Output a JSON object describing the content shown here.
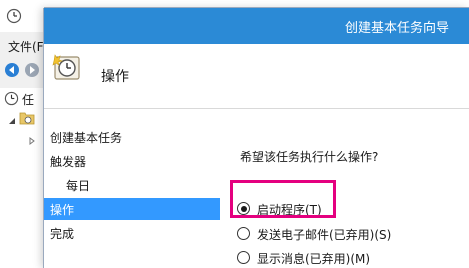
{
  "background_app": {
    "menu": {
      "file_label": "文件(F"
    },
    "tree": {
      "root_label": "任",
      "child_label": ""
    },
    "icons": {
      "app_icon": "clock-icon",
      "back": "back-arrow-icon",
      "forward": "forward-arrow-icon",
      "tree_root": "clock-icon",
      "tree_folder": "folder-icon",
      "tree_expand": "triangle-expand-icon",
      "tree_collapsed": "triangle-collapsed-icon"
    }
  },
  "wizard": {
    "window_title": "创建基本任务向导",
    "header_title": "操作",
    "header_icon": "task-clock-icon",
    "nav": [
      {
        "label": "创建基本任务",
        "selected": false,
        "indent": false
      },
      {
        "label": "触发器",
        "selected": false,
        "indent": false
      },
      {
        "label": "每日",
        "selected": false,
        "indent": true
      },
      {
        "label": "操作",
        "selected": true,
        "indent": false
      },
      {
        "label": "完成",
        "selected": false,
        "indent": false
      }
    ],
    "prompt": "希望该任务执行什么操作?",
    "options": [
      {
        "label": "启动程序(T)",
        "checked": true
      },
      {
        "label": "发送电子邮件(已弃用)(S)",
        "checked": false
      },
      {
        "label": "显示消息(已弃用)(M)",
        "checked": false
      }
    ],
    "accent_color": "#2b8ad6",
    "selection_color": "#3399ff",
    "highlight_color": "#e4007f"
  }
}
